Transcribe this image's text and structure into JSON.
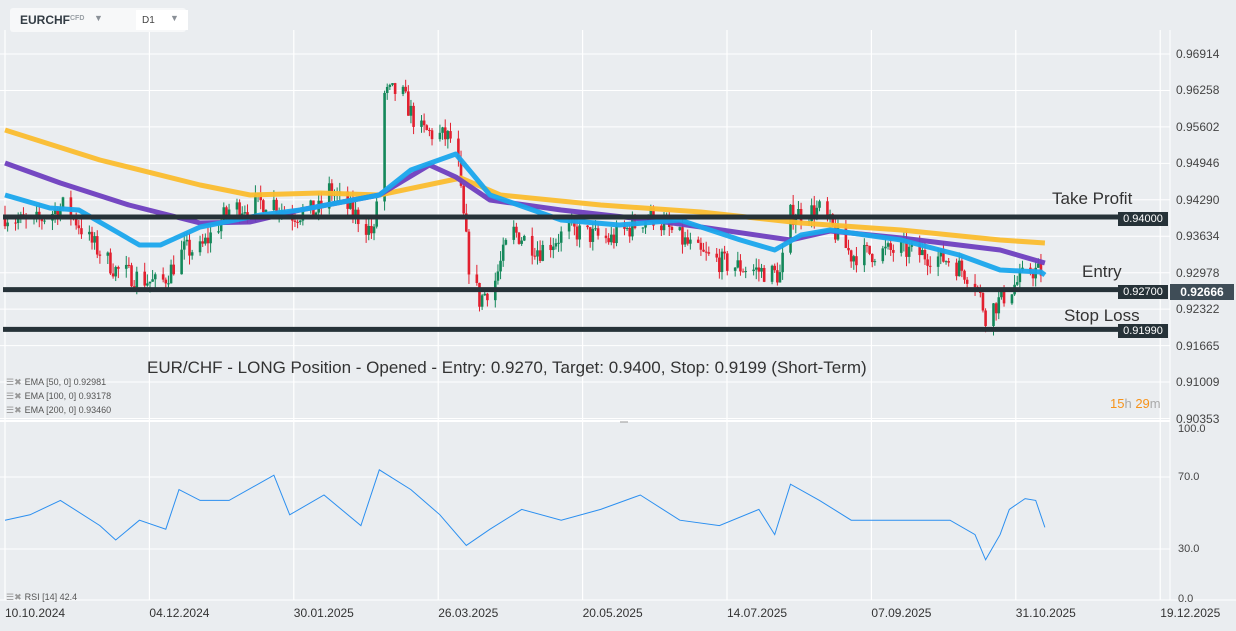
{
  "toolbar": {
    "symbol": "EURCHF",
    "symbol_type": "CFD",
    "timeframe": "D1",
    "dropdown_icon": "caret-down-icon"
  },
  "price_axis": [
    "0.96914",
    "0.96258",
    "0.95602",
    "0.94946",
    "0.94290",
    "0.93634",
    "0.92978",
    "0.92322",
    "0.91665",
    "0.91009",
    "0.90353"
  ],
  "date_axis": [
    "10.10.2024",
    "04.12.2024",
    "30.01.2025",
    "26.03.2025",
    "20.05.2025",
    "14.07.2025",
    "07.09.2025",
    "31.10.2025",
    "19.12.2025"
  ],
  "levels": [
    {
      "name": "Take Profit",
      "price": 0.94,
      "tag": "0.94000"
    },
    {
      "name": "Entry",
      "price": 0.927,
      "tag": "0.92700"
    },
    {
      "name": "Stop Loss",
      "price": 0.9199,
      "tag": "0.91990"
    }
  ],
  "current_price": "0.92666",
  "annotation": "EUR/CHF - LONG Position - Opened - Entry: 0.9270, Target: 0.9400, Stop: 0.9199 (Short-Term)",
  "indicators": [
    {
      "label": "EMA [50,  0] 0.92981",
      "color": "#1aa7ec"
    },
    {
      "label": "EMA [100,  0] 0.93178",
      "color": "#6f3fbf"
    },
    {
      "label": "EMA [200,  0] 0.93460",
      "color": "#fbbd2e"
    }
  ],
  "timer": {
    "hours": "15",
    "h": "h",
    "minutes": "29",
    "m": "m"
  },
  "rsi": {
    "label": "RSI [14]  42.4",
    "axis": [
      "100.0",
      "70.0",
      "30.0",
      "0.0"
    ]
  },
  "chart_data": {
    "type": "candlestick",
    "x_unit": "days since 10.10.2024",
    "ylim": [
      0.90353,
      0.96914
    ],
    "colors": {
      "up": "#14885a",
      "down": "#e2202f",
      "grid": "#ffffff",
      "level": "#263238"
    },
    "close_anchors": [
      [
        0,
        0.94035
      ],
      [
        9.5,
        0.93857
      ],
      [
        23,
        0.94214
      ],
      [
        32,
        0.93589
      ],
      [
        42,
        0.93052
      ],
      [
        59,
        0.92784
      ],
      [
        68,
        0.9341
      ],
      [
        74,
        0.9341
      ],
      [
        85,
        0.94125
      ],
      [
        101,
        0.94304
      ],
      [
        108,
        0.94035
      ],
      [
        119.5,
        0.94125
      ],
      [
        123,
        0.94482
      ],
      [
        135,
        0.93946
      ],
      [
        140,
        0.93678
      ],
      [
        144,
        0.96181
      ],
      [
        150,
        0.9627
      ],
      [
        157,
        0.95555
      ],
      [
        171,
        0.95376
      ],
      [
        173,
        0.94393
      ],
      [
        176,
        0.93141
      ],
      [
        180,
        0.92516
      ],
      [
        186,
        0.92873
      ],
      [
        192,
        0.93767
      ],
      [
        203,
        0.9341
      ],
      [
        214,
        0.93767
      ],
      [
        229.5,
        0.93589
      ],
      [
        245,
        0.94035
      ],
      [
        264,
        0.9332
      ],
      [
        275,
        0.93141
      ],
      [
        294,
        0.92963
      ],
      [
        298,
        0.94035
      ],
      [
        309,
        0.94125
      ],
      [
        321,
        0.9332
      ],
      [
        340,
        0.9341
      ],
      [
        358.5,
        0.93231
      ],
      [
        368,
        0.92873
      ],
      [
        372,
        0.92248
      ],
      [
        377.5,
        0.92516
      ],
      [
        383,
        0.92784
      ],
      [
        389,
        0.93052
      ],
      [
        393,
        0.93016
      ],
      [
        394.5,
        0.92666
      ]
    ],
    "ema200": [
      [
        0,
        0.95555
      ],
      [
        36,
        0.95019
      ],
      [
        74,
        0.94572
      ],
      [
        93,
        0.94393
      ],
      [
        119.5,
        0.94429
      ],
      [
        142,
        0.94393
      ],
      [
        173,
        0.94697
      ],
      [
        188,
        0.94393
      ],
      [
        226,
        0.94214
      ],
      [
        264,
        0.94089
      ],
      [
        302,
        0.93892
      ],
      [
        340,
        0.93767
      ],
      [
        377.5,
        0.93589
      ],
      [
        394.5,
        0.93535
      ]
    ],
    "ema100": [
      [
        0,
        0.94965
      ],
      [
        21,
        0.94607
      ],
      [
        47,
        0.94214
      ],
      [
        74,
        0.93892
      ],
      [
        93,
        0.9391
      ],
      [
        112,
        0.94125
      ],
      [
        142,
        0.94393
      ],
      [
        161,
        0.94929
      ],
      [
        171,
        0.94715
      ],
      [
        184,
        0.94304
      ],
      [
        211,
        0.94125
      ],
      [
        245,
        0.93946
      ],
      [
        264,
        0.93821
      ],
      [
        298,
        0.93589
      ],
      [
        313,
        0.9375
      ],
      [
        340,
        0.93624
      ],
      [
        377.5,
        0.9341
      ],
      [
        394.5,
        0.93177
      ]
    ],
    "ema50": [
      [
        0,
        0.94393
      ],
      [
        17,
        0.94161
      ],
      [
        28,
        0.94125
      ],
      [
        51,
        0.93499
      ],
      [
        59,
        0.93499
      ],
      [
        74,
        0.93821
      ],
      [
        97,
        0.94035
      ],
      [
        112,
        0.94125
      ],
      [
        142,
        0.94393
      ],
      [
        154,
        0.9484
      ],
      [
        171,
        0.95126
      ],
      [
        184,
        0.94393
      ],
      [
        211,
        0.93946
      ],
      [
        233,
        0.93857
      ],
      [
        256,
        0.93946
      ],
      [
        279,
        0.93589
      ],
      [
        292,
        0.9341
      ],
      [
        302,
        0.93678
      ],
      [
        313,
        0.93767
      ],
      [
        340,
        0.93589
      ],
      [
        362,
        0.9332
      ],
      [
        377.5,
        0.93052
      ],
      [
        393,
        0.93016
      ],
      [
        394.5,
        0.92963
      ]
    ],
    "rsi_range": [
      0,
      100
    ],
    "rsi": [
      [
        0,
        46
      ],
      [
        9.5,
        49
      ],
      [
        21,
        57
      ],
      [
        36,
        43
      ],
      [
        42,
        35
      ],
      [
        51,
        46
      ],
      [
        61,
        41
      ],
      [
        66,
        63
      ],
      [
        74,
        57
      ],
      [
        85,
        57
      ],
      [
        102,
        71
      ],
      [
        108,
        49
      ],
      [
        121,
        60
      ],
      [
        135,
        43
      ],
      [
        142,
        74
      ],
      [
        154,
        63
      ],
      [
        165,
        49
      ],
      [
        175,
        32
      ],
      [
        184,
        41
      ],
      [
        196,
        52
      ],
      [
        211,
        46
      ],
      [
        226,
        52
      ],
      [
        241,
        60
      ],
      [
        256,
        46
      ],
      [
        271,
        43
      ],
      [
        286,
        52
      ],
      [
        292,
        38
      ],
      [
        298,
        66
      ],
      [
        309,
        57
      ],
      [
        321,
        46
      ],
      [
        340,
        46
      ],
      [
        358.5,
        46
      ],
      [
        368,
        38
      ],
      [
        372,
        24
      ],
      [
        377.5,
        38
      ],
      [
        381,
        52
      ],
      [
        387,
        58
      ],
      [
        391,
        57
      ],
      [
        394.5,
        42
      ]
    ]
  }
}
